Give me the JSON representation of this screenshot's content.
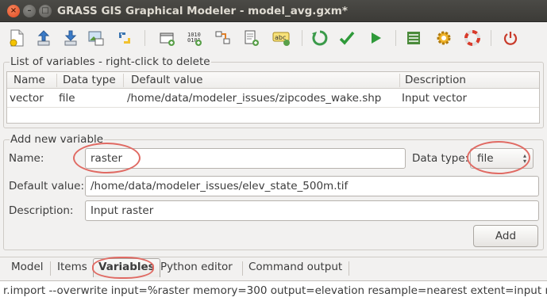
{
  "window": {
    "title": "GRASS GIS Graphical Modeler - model_avg.gxm*",
    "close_glyph": "×",
    "minimize_glyph": "–",
    "maximize_glyph": "□"
  },
  "toolbar": {
    "icons": [
      "new-file-icon",
      "open-upload-icon",
      "save-download-icon",
      "export-image-icon",
      "python-icon",
      "add-command-icon",
      "add-data-icon",
      "add-relation-icon",
      "add-loop-icon",
      "add-comment-icon",
      "redraw-icon",
      "validate-icon",
      "run-icon",
      "properties-icon",
      "settings-icon",
      "help-icon",
      "quit-icon"
    ]
  },
  "variables_list": {
    "title": "List of variables - right-click to delete",
    "columns": [
      "Name",
      "Data type",
      "Default value",
      "Description"
    ],
    "rows": [
      {
        "name": "vector",
        "type": "file",
        "default": "/home/data/modeler_issues/zipcodes_wake.shp",
        "description": "Input vector"
      }
    ]
  },
  "add_variable": {
    "title": "Add new variable",
    "name_label": "Name:",
    "name_value": "raster",
    "data_type_label": "Data type:",
    "data_type_value": "file",
    "default_label": "Default value:",
    "default_value": "/home/data/modeler_issues/elev_state_500m.tif",
    "description_label": "Description:",
    "description_value": "Input raster",
    "add_button": "Add"
  },
  "tabs": {
    "items": [
      "Model",
      "Items",
      "Variables",
      "Python editor",
      "Command output"
    ],
    "active": "Variables"
  },
  "command_line": "r.import --overwrite input=%raster memory=300 output=elevation resample=nearest extent=input res",
  "colors": {
    "titlebar": "#3c3b37",
    "annotation": "#e06a63",
    "active_tab": "#e06a63"
  }
}
